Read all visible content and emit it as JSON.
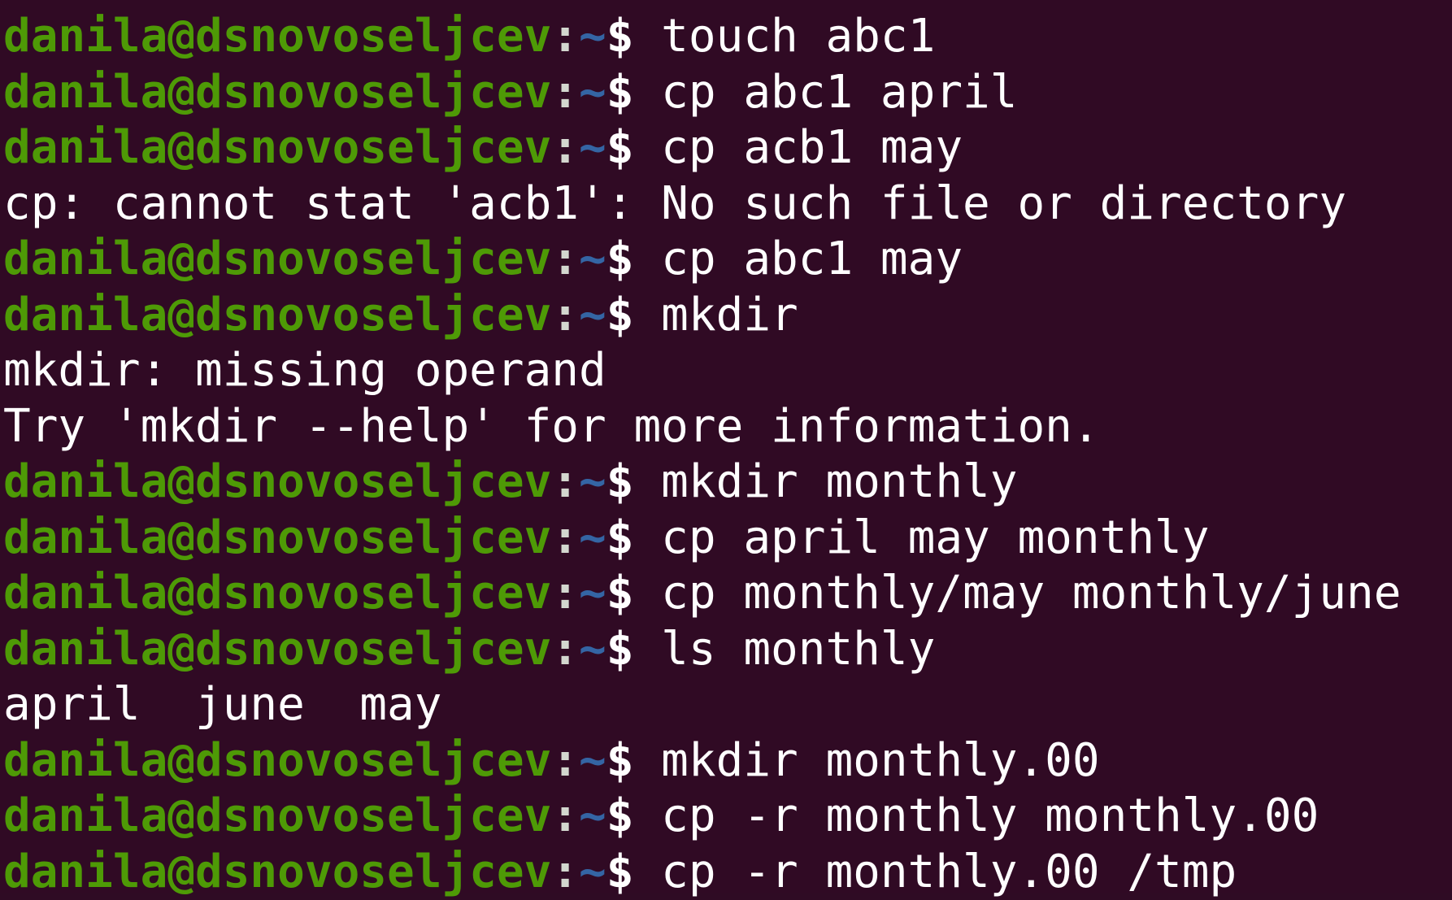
{
  "terminal": {
    "prompt": {
      "user_host": "danila@dsnovoseljcev",
      "separator": ":",
      "path": "~",
      "symbol": "$ "
    },
    "lines": [
      {
        "type": "prompt",
        "text": "touch abc1"
      },
      {
        "type": "prompt",
        "text": "cp abc1 april"
      },
      {
        "type": "prompt",
        "text": "cp acb1 may"
      },
      {
        "type": "output",
        "text": "cp: cannot stat 'acb1': No such file or directory"
      },
      {
        "type": "prompt",
        "text": "cp abc1 may"
      },
      {
        "type": "prompt",
        "text": "mkdir"
      },
      {
        "type": "output",
        "text": "mkdir: missing operand"
      },
      {
        "type": "output",
        "text": "Try 'mkdir --help' for more information."
      },
      {
        "type": "prompt",
        "text": "mkdir monthly"
      },
      {
        "type": "prompt",
        "text": "cp april may monthly"
      },
      {
        "type": "prompt",
        "text": "cp monthly/may monthly/june"
      },
      {
        "type": "prompt",
        "text": "ls monthly"
      },
      {
        "type": "output",
        "text": "april  june  may"
      },
      {
        "type": "prompt",
        "text": "mkdir monthly.00"
      },
      {
        "type": "prompt",
        "text": "cp -r monthly monthly.00"
      },
      {
        "type": "prompt",
        "text": "cp -r monthly.00 /tmp"
      }
    ]
  },
  "colors": {
    "background": "#300a24",
    "user_host": "#4e9a06",
    "path": "#3465a4",
    "text": "#ffffff"
  }
}
